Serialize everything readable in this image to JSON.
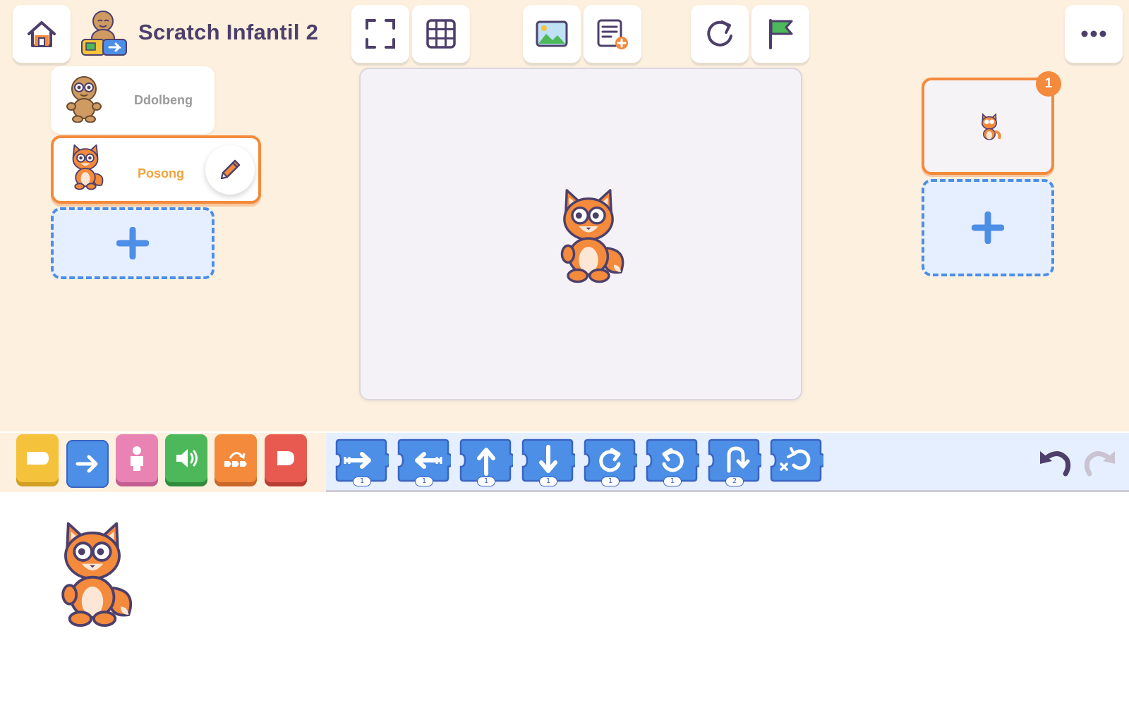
{
  "app": {
    "title": "Scratch Infantil 2"
  },
  "toolbar": {
    "left": [
      {
        "id": "home",
        "icon": "home-icon"
      }
    ],
    "center": [
      {
        "id": "fullscreen",
        "icon": "fullscreen-icon"
      },
      {
        "id": "grid",
        "icon": "grid-icon"
      },
      {
        "id": "background",
        "icon": "image-icon"
      },
      {
        "id": "add-text",
        "icon": "text-add-icon"
      },
      {
        "id": "reset",
        "icon": "refresh-icon"
      },
      {
        "id": "green-flag",
        "icon": "flag-icon"
      }
    ],
    "right": [
      {
        "id": "more",
        "icon": "ellipsis-icon"
      }
    ]
  },
  "sprites": [
    {
      "name": "Ddolbeng",
      "selected": false
    },
    {
      "name": "Posong",
      "selected": true
    }
  ],
  "pages": [
    {
      "number": "1",
      "selected": true
    }
  ],
  "categories": [
    {
      "id": "triggers",
      "color": "#f5c33b",
      "icon": "trigger-icon"
    },
    {
      "id": "motion",
      "color": "#4d8ee6",
      "icon": "arrow-right-icon"
    },
    {
      "id": "looks",
      "color": "#e883b3",
      "icon": "person-icon"
    },
    {
      "id": "sound",
      "color": "#4cb85a",
      "icon": "speaker-icon"
    },
    {
      "id": "control",
      "color": "#f38a3c",
      "icon": "control-icon"
    },
    {
      "id": "end",
      "color": "#e85a4f",
      "icon": "end-icon"
    }
  ],
  "motion_blocks": [
    {
      "id": "move-right",
      "icon": "move-right-icon",
      "value": "1"
    },
    {
      "id": "move-left",
      "icon": "move-left-icon",
      "value": "1"
    },
    {
      "id": "move-up",
      "icon": "move-up-icon",
      "value": "1"
    },
    {
      "id": "move-down",
      "icon": "move-down-icon",
      "value": "1"
    },
    {
      "id": "turn-right",
      "icon": "turn-right-icon",
      "value": "1"
    },
    {
      "id": "turn-left",
      "icon": "turn-left-icon",
      "value": "1"
    },
    {
      "id": "hop",
      "icon": "hop-icon",
      "value": "2"
    },
    {
      "id": "go-home",
      "icon": "go-home-icon",
      "value": ""
    }
  ],
  "colors": {
    "accent": "#f38a3c",
    "motion": "#4d8ee6",
    "background": "#fdf0de",
    "title": "#4d3f6b"
  }
}
